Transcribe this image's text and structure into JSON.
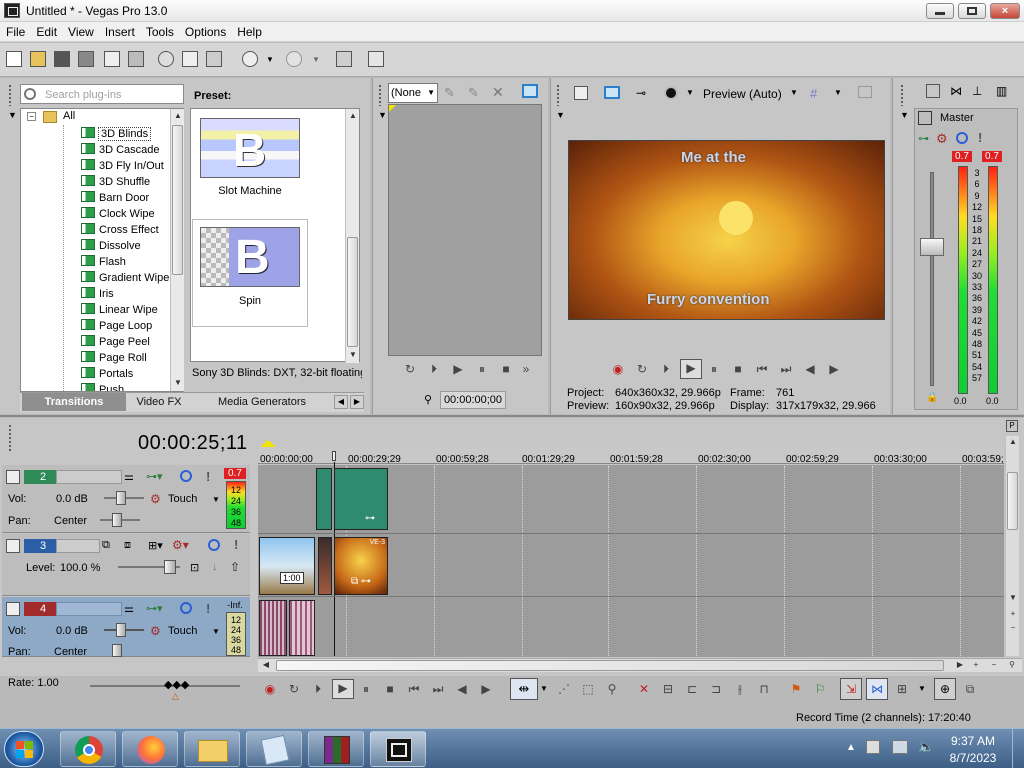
{
  "window": {
    "title": "Untitled * - Vegas Pro 13.0",
    "minimize": "0",
    "maximize": "1",
    "close": "r"
  },
  "menu": [
    "File",
    "Edit",
    "View",
    "Insert",
    "Tools",
    "Options",
    "Help"
  ],
  "plugins": {
    "search_placeholder": "Search plug-ins",
    "preset_label": "Preset:",
    "tree_root": "All",
    "items": [
      "3D Blinds",
      "3D Cascade",
      "3D Fly In/Out",
      "3D Shuffle",
      "Barn Door",
      "Clock Wipe",
      "Cross Effect",
      "Dissolve",
      "Flash",
      "Gradient Wipe",
      "Iris",
      "Linear Wipe",
      "Page Loop",
      "Page Peel",
      "Page Roll",
      "Portals",
      "Push"
    ],
    "selected": "3D Blinds",
    "presets": [
      {
        "name": "Slot Machine",
        "letter": "B"
      },
      {
        "name": "Spin",
        "letter": "B"
      }
    ],
    "description": "Sony 3D Blinds: DXT, 32-bit floating",
    "tabs": [
      "Transitions",
      "Video FX",
      "Media Generators"
    ]
  },
  "trimmer": {
    "dropdown": "(None",
    "timecode": "00:00:00;00"
  },
  "preview": {
    "mode": "Preview (Auto)",
    "video_text_top": "Me at the",
    "video_text_bottom": "Furry convention",
    "project_label": "Project:",
    "project_value": "640x360x32, 29.966p",
    "frame_label": "Frame:",
    "frame_value": "761",
    "preview_label": "Preview:",
    "preview_value": "160x90x32, 29.966p",
    "display_label": "Display:",
    "display_value": "317x179x32, 29.966"
  },
  "master": {
    "title": "Master",
    "peak_left": "0.7",
    "peak_right": "0.7",
    "scale": [
      "3",
      "6",
      "9",
      "12",
      "15",
      "18",
      "21",
      "24",
      "27",
      "30",
      "33",
      "36",
      "39",
      "42",
      "45",
      "48",
      "51",
      "54",
      "57"
    ],
    "bottom_left": "0.0",
    "bottom_right": "0.0"
  },
  "timeline": {
    "timecode": "00:00:25;11",
    "ruler": [
      "00:00:00;00",
      "00:00:29;29",
      "00:00:59;28",
      "00:01:29;29",
      "00:01:59;28",
      "00:02:30;00",
      "00:02:59;29",
      "00:03:30;00",
      "00:03:59;"
    ],
    "tracks": [
      {
        "num": "2",
        "vol_label": "Vol:",
        "vol_value": "0.0 dB",
        "pan_label": "Pan:",
        "pan_value": "Center",
        "mode": "Touch",
        "peak": "0.7",
        "meter_scale": [
          "12",
          "24",
          "36",
          "48"
        ],
        "color": "#2e8b57"
      },
      {
        "num": "3",
        "level_label": "Level:",
        "level_value": "100.0 %",
        "color": "#2a5fa8"
      },
      {
        "num": "4",
        "vol_label": "Vol:",
        "vol_value": "0.0 dB",
        "pan_label": "Pan:",
        "pan_value": "Center",
        "mode": "Touch",
        "peak": "-Inf.",
        "meter_scale": [
          "12",
          "24",
          "36",
          "48"
        ],
        "color": "#a12b2b"
      }
    ],
    "clip_time": "1:00",
    "clip_tag": "VE-3",
    "rate": "Rate: 1.00",
    "record_time": "Record Time (2 channels): 17:20:40"
  },
  "taskbar": {
    "time": "9:37 AM",
    "date": "8/7/2023"
  },
  "colors": {
    "accent": "#3d5f86",
    "selection": "#3399ff",
    "meter_peak": "#e02020"
  }
}
